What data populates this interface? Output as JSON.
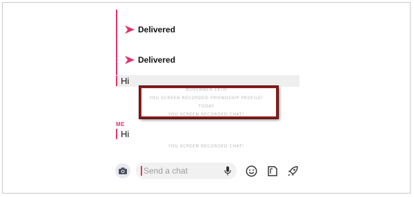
{
  "messages": {
    "delivered_1": "Delivered",
    "delivered_2": "Delivered",
    "hi_1": "Hi",
    "me_label": "ME",
    "hi_2": "Hi"
  },
  "system": {
    "date": "NOVEMBER 16TH",
    "profile_recorded": "YOU SCREEN RECORDED FRIENDSHIP PROFILE!",
    "today": "TODAY",
    "chat_recorded_1": "YOU SCREEN RECORDED CHAT!",
    "chat_recorded_2": "YOU SCREEN RECORDED CHAT!"
  },
  "input": {
    "placeholder": "Send a chat"
  },
  "icons": {
    "delivered": "send-arrow-icon",
    "camera": "camera-icon",
    "mic": "microphone-icon",
    "emoji": "smiley-icon",
    "stickers": "sticker-icon",
    "games": "rocket-icon"
  },
  "colors": {
    "accent": "#e0336a",
    "highlight_border": "#8b1c1c",
    "system_text": "#b9b9b9"
  }
}
